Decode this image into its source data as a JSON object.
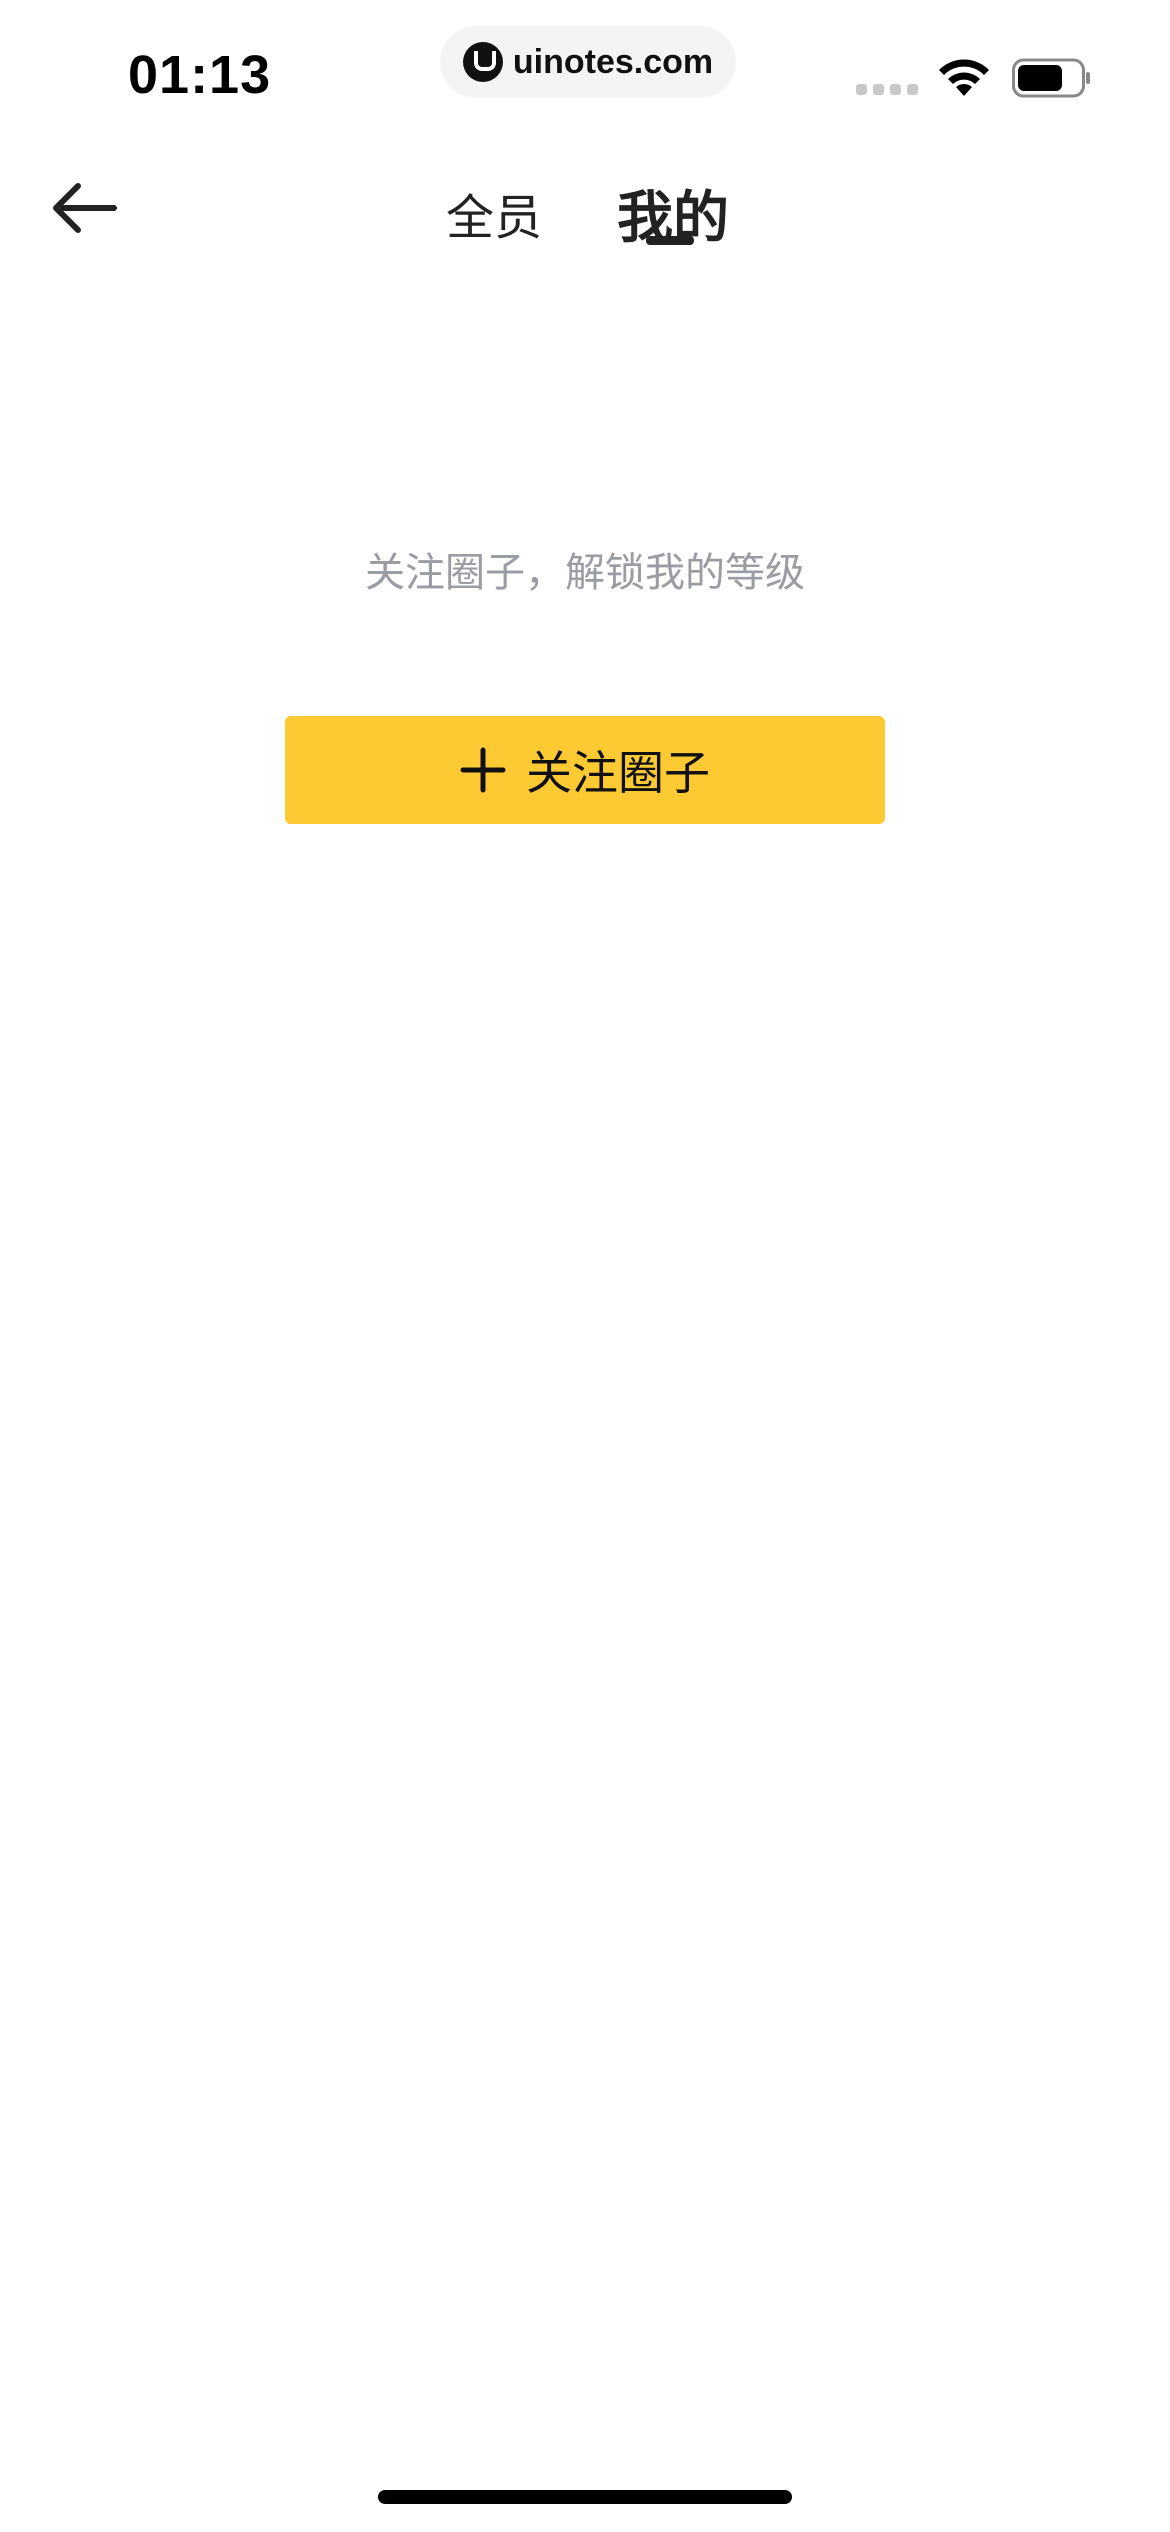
{
  "status_bar": {
    "time": "01:13",
    "url": "uinotes.com"
  },
  "nav": {
    "tabs": [
      {
        "label": "全员",
        "active": false
      },
      {
        "label": "我的",
        "active": true
      }
    ]
  },
  "empty_state": {
    "hint": "关注圈子，解锁我的等级",
    "button_label": "关注圈子"
  },
  "colors": {
    "accent": "#fdca33",
    "hint_text": "#9a9ca3",
    "primary_text": "#222222"
  },
  "icons": {
    "back": "arrow-left-icon",
    "plus": "plus-icon",
    "wifi": "wifi-icon",
    "battery": "battery-icon"
  }
}
